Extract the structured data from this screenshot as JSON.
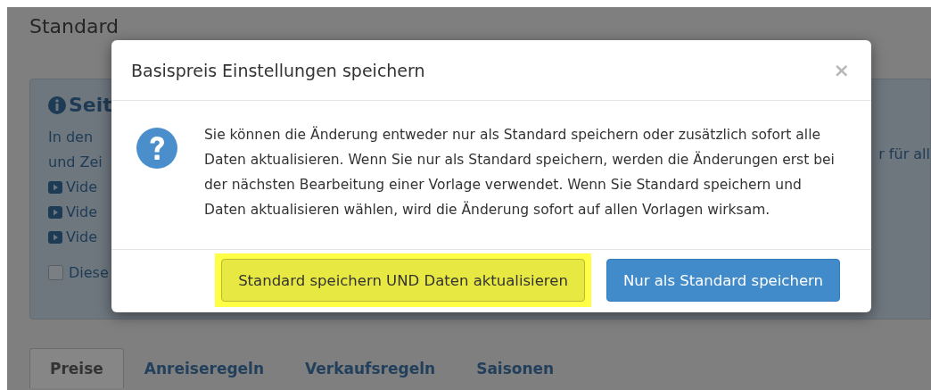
{
  "page": {
    "title": "Standard",
    "info": {
      "heading": "Seit",
      "lines": [
        "In den",
        "und Zei"
      ],
      "videos": [
        "Vide",
        "Vide",
        "Vide"
      ],
      "checkbox": {
        "label": "Diese",
        "checked": false
      },
      "right_text": "r für all"
    },
    "tabs": [
      {
        "label": "Preise",
        "selected": true
      },
      {
        "label": "Anreiseregeln",
        "selected": false
      },
      {
        "label": "Verkaufsregeln",
        "selected": false
      },
      {
        "label": "Saisonen",
        "selected": false
      }
    ]
  },
  "dialog": {
    "title": "Basispreis Einstellungen speichern",
    "close": "×",
    "message": "Sie können die Änderung entweder nur als Standard speichern oder zusätzlich sofort alle Daten aktualisieren. Wenn Sie nur als Standard speichern, werden die Änderungen erst bei der nächsten Bearbeitung einer Vorlage verwendet. Wenn Sie Standard speichern und Daten aktualisieren wählen, wird die Änderung sofort auf allen Vorlagen wirksam.",
    "buttons": [
      {
        "label": "Standard speichern UND Daten aktualisieren",
        "kind": "warning",
        "highlighted": true
      },
      {
        "label": "Nur als Standard speichern",
        "kind": "primary",
        "highlighted": false
      }
    ]
  }
}
